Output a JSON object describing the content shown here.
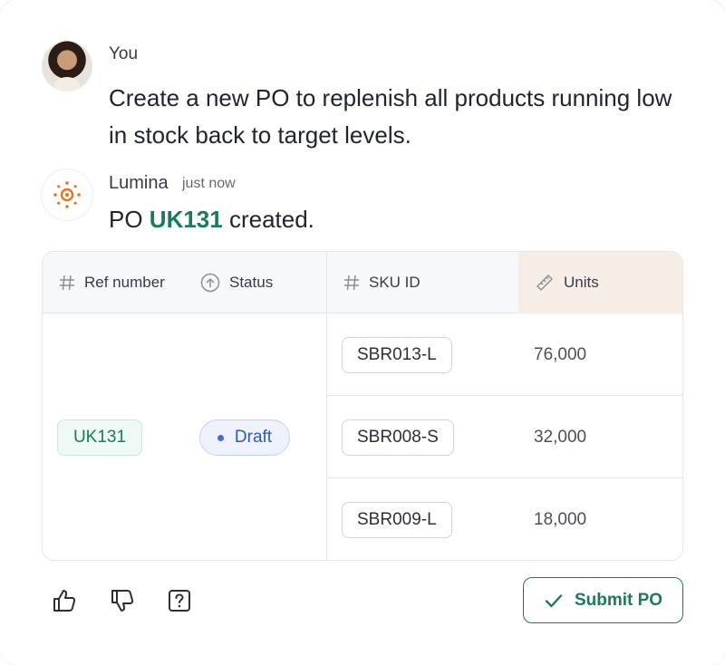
{
  "user": {
    "name": "You",
    "message": "Create a new PO to replenish all products running low in stock back to target levels."
  },
  "assistant": {
    "name": "Lumina",
    "time": "just now",
    "message_prefix": "PO ",
    "po_number": "UK131",
    "message_suffix": " created."
  },
  "table": {
    "headers": {
      "ref": "Ref number",
      "status": "Status",
      "sku": "SKU ID",
      "units": "Units"
    },
    "ref": "UK131",
    "status": "Draft",
    "rows": [
      {
        "sku": "SBR013-L",
        "units": "76,000"
      },
      {
        "sku": "SBR008-S",
        "units": "32,000"
      },
      {
        "sku": "SBR009-L",
        "units": "18,000"
      }
    ]
  },
  "actions": {
    "submit_label": "Submit PO"
  },
  "colors": {
    "accent": "#1a7a5e",
    "status_blue": "#3356b8",
    "units_header_bg": "#f7ede7"
  }
}
